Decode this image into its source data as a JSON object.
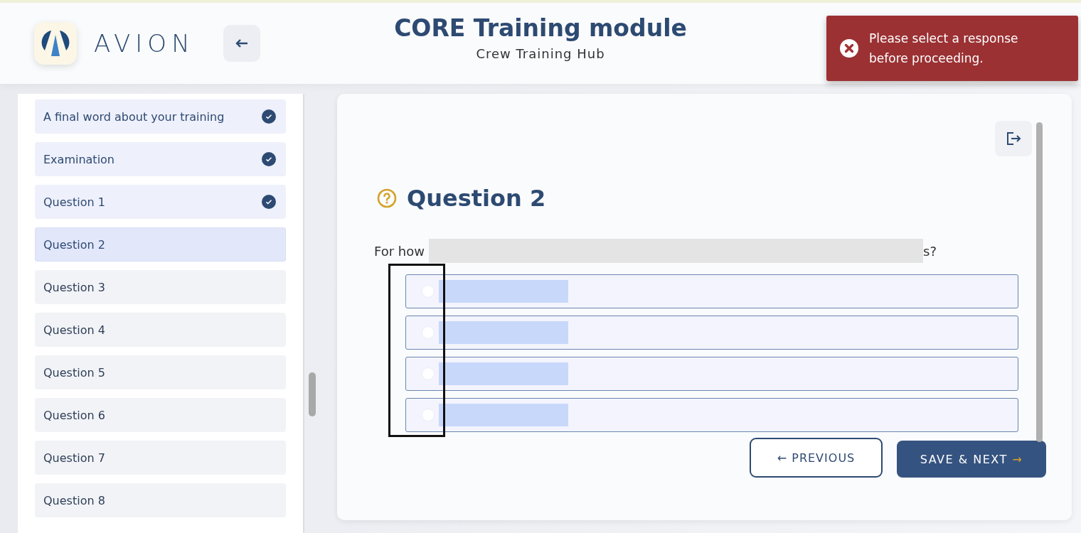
{
  "header": {
    "brand": "AVION",
    "title": "CORE Training module",
    "subtitle": "Crew Training Hub"
  },
  "toast": {
    "kind": "error",
    "message": "Please select a response before proceeding."
  },
  "sidebar": {
    "items": [
      {
        "label": "A final word about your training",
        "completed": true,
        "selected": false
      },
      {
        "label": "Examination",
        "completed": true,
        "selected": false
      },
      {
        "label": "Question 1",
        "completed": true,
        "selected": false
      },
      {
        "label": "Question 2",
        "completed": false,
        "selected": true
      },
      {
        "label": "Question 3",
        "completed": false,
        "selected": false
      },
      {
        "label": "Question 4",
        "completed": false,
        "selected": false
      },
      {
        "label": "Question 5",
        "completed": false,
        "selected": false
      },
      {
        "label": "Question 6",
        "completed": false,
        "selected": false
      },
      {
        "label": "Question 7",
        "completed": false,
        "selected": false
      },
      {
        "label": "Question 8",
        "completed": false,
        "selected": false
      }
    ]
  },
  "question": {
    "title": "Question 2",
    "text_start": "For how",
    "text_end": "s?",
    "options": [
      {
        "selected": false
      },
      {
        "selected": false
      },
      {
        "selected": false
      },
      {
        "selected": false
      }
    ]
  },
  "buttons": {
    "previous": "← PREVIOUS",
    "next": "SAVE & NEXT",
    "next_arrow": "→"
  }
}
